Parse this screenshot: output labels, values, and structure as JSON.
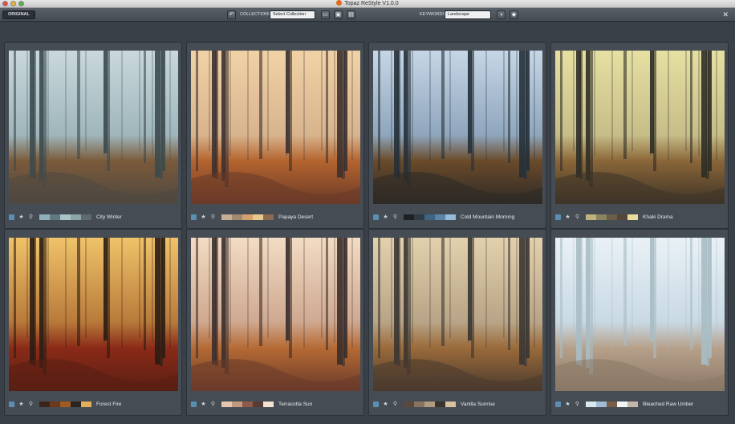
{
  "window": {
    "title": "Topaz ReStyle V1.0.0"
  },
  "toolbar": {
    "original_label": "ORIGINAL",
    "collections_label": "COLLECTIONS:",
    "collections_value": "Select Collection",
    "keywords_label": "KEYWORDS:",
    "keywords_value": "Landscape",
    "icons": [
      "undo-icon",
      "folder-icon",
      "save-icon",
      "export-icon",
      "filter-icon",
      "tag-icon",
      "close-icon"
    ]
  },
  "presets": [
    {
      "name": "City Winter",
      "swatches": [
        "#8fb0ba",
        "#5f7a80",
        "#a9c3c8",
        "#8ea5a8",
        "#5e6a6b"
      ],
      "tint": {
        "sky": "#c9d8dc",
        "fog": "#9fb6bc",
        "ground": "#4f4840",
        "leaf": "#7a5a3a",
        "trunk": "#3c4a4e"
      }
    },
    {
      "name": "Papaya Desert",
      "swatches": [
        "#c9ad92",
        "#a08a73",
        "#d4a06c",
        "#e8c98a",
        "#8c6a52"
      ],
      "tint": {
        "sky": "#f1d2a6",
        "fog": "#d8b48e",
        "ground": "#6a3a28",
        "leaf": "#b4642e",
        "trunk": "#3b3030"
      }
    },
    {
      "name": "Cold Mountain Morning",
      "swatches": [
        "#1e2024",
        "#2f3a44",
        "#3e6383",
        "#5c84a8",
        "#96bbd8"
      ],
      "tint": {
        "sky": "#c6d6e6",
        "fog": "#8fa6bd",
        "ground": "#2e2a26",
        "leaf": "#6a4a2a",
        "trunk": "#253039"
      }
    },
    {
      "name": "Khaki Drama",
      "swatches": [
        "#bfb27a",
        "#8b8460",
        "#6a5e48",
        "#55463a",
        "#e9dc9a"
      ],
      "tint": {
        "sky": "#e6e0a2",
        "fog": "#c6bd88",
        "ground": "#3e3428",
        "leaf": "#8a6638",
        "trunk": "#2d2d26"
      }
    },
    {
      "name": "Forest Fire",
      "swatches": [
        "#3b2418",
        "#6b3a1c",
        "#a05a22",
        "#2a2420",
        "#e2b05a"
      ],
      "tint": {
        "sky": "#f0c36a",
        "fog": "#b87a3a",
        "ground": "#5a1f14",
        "leaf": "#8a2a18",
        "trunk": "#2a1d14"
      }
    },
    {
      "name": "Terracotta Sun",
      "swatches": [
        "#e6c6ae",
        "#c49a7e",
        "#8e5a4a",
        "#5a3a34",
        "#f4e2d0"
      ],
      "tint": {
        "sky": "#f3dcc4",
        "fog": "#cfa890",
        "ground": "#6a3a2a",
        "leaf": "#b56a34",
        "trunk": "#3a2e2c"
      }
    },
    {
      "name": "Vanilla Sunrise",
      "swatches": [
        "#5a4a3e",
        "#8a735e",
        "#b09a80",
        "#3a3430",
        "#d6c29e"
      ],
      "tint": {
        "sky": "#e3d1ad",
        "fog": "#b8a486",
        "ground": "#4a3a2e",
        "leaf": "#9a6a3a",
        "trunk": "#3a3633"
      }
    },
    {
      "name": "Bleached Raw Umber",
      "swatches": [
        "#d8e6f0",
        "#9fbcd4",
        "#7a5e4a",
        "#f0f4f6",
        "#c2b6aa"
      ],
      "tint": {
        "sky": "#e9f1f6",
        "fog": "#c9d9e4",
        "ground": "#8a7866",
        "leaf": "#b6a08a",
        "trunk": "#a9bcc4"
      }
    }
  ]
}
